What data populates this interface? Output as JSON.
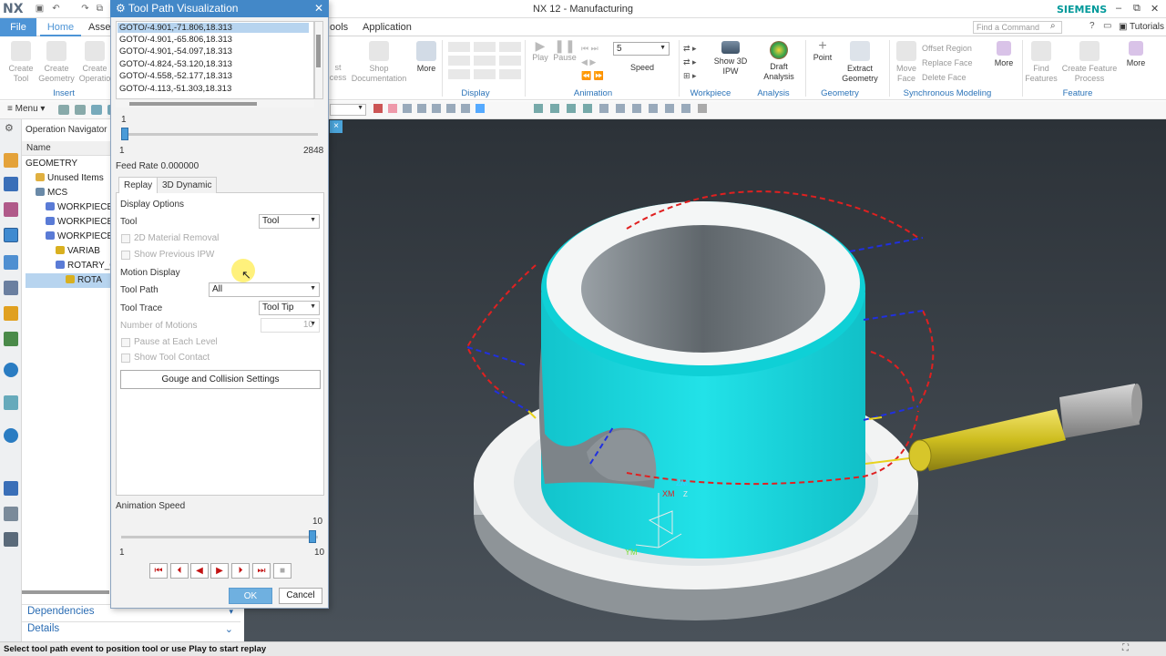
{
  "app": {
    "logo": "NX",
    "window_title": "NX 12 - Manufacturing",
    "brand": "SIEMENS",
    "tutorials": "Tutorials",
    "find_placeholder": "Find a Command"
  },
  "menu": {
    "file": "File",
    "home": "Home",
    "assemblies": "Asse",
    "tools": "ools",
    "application": "Application"
  },
  "ribbon": {
    "create_tool": [
      "Create",
      "Tool"
    ],
    "create_geometry": [
      "Create",
      "Geometry"
    ],
    "create_operation": [
      "Create",
      "Operatio"
    ],
    "insert_group": "Insert",
    "process": [
      "st",
      "cess"
    ],
    "shop_documentation": [
      "Shop",
      "Documentation"
    ],
    "more": "More",
    "display_group": "Display",
    "play": "Play",
    "pause": "Pause",
    "speed_value": "5",
    "speed": "Speed",
    "animation_group": "Animation",
    "show_3d_ipw": [
      "Show 3D",
      "IPW"
    ],
    "workpiece_group": "Workpiece",
    "draft_analysis": [
      "Draft",
      "Analysis"
    ],
    "analysis_group": "Analysis",
    "point": "Point",
    "extract_geometry": [
      "Extract",
      "Geometry"
    ],
    "geometry_group": "Geometry",
    "move_face": [
      "Move",
      "Face"
    ],
    "offset_region": "Offset Region",
    "replace_face": "Replace Face",
    "delete_face": "Delete Face",
    "synchronous_group": "Synchronous Modeling",
    "more2": "More",
    "find_features": [
      "Find",
      "Features"
    ],
    "create_feature_process": [
      "Create Feature",
      "Process"
    ],
    "feature_group": "Feature",
    "more3": "More"
  },
  "toolbar": {
    "menu": "Menu"
  },
  "navigator": {
    "title": "Operation Navigator",
    "column_name": "Name",
    "items": [
      {
        "label": "GEOMETRY",
        "indent": 0
      },
      {
        "label": "Unused Items",
        "indent": 1
      },
      {
        "label": "MCS",
        "indent": 1
      },
      {
        "label": "WORKPIECE",
        "indent": 2
      },
      {
        "label": "WORKPIECE_",
        "indent": 2
      },
      {
        "label": "WORKPIECE_",
        "indent": 2
      },
      {
        "label": "VARIAB",
        "indent": 3
      },
      {
        "label": "ROTARY_C",
        "indent": 3
      },
      {
        "label": "ROTA",
        "indent": 4
      }
    ],
    "dependencies": "Dependencies",
    "details": "Details"
  },
  "dialog": {
    "title": "Tool Path Visualization",
    "goto_list": [
      "GOTO/-4.901,-71.806,18.313",
      "GOTO/-4.901,-65.806,18.313",
      "GOTO/-4.901,-54.097,18.313",
      "GOTO/-4.824,-53.120,18.313",
      "GOTO/-4.558,-52.177,18.313",
      "GOTO/-4.113,-51.303,18.313"
    ],
    "motion_value": "1",
    "motion_min": "1",
    "motion_max": "2848",
    "motion_fraction": 0.0,
    "feed_rate": "Feed Rate 0.000000",
    "tab_replay": "Replay",
    "tab_3d": "3D Dynamic",
    "display_options": "Display Options",
    "tool_label": "Tool",
    "tool_value": "Tool",
    "material_removal": "2D Material Removal",
    "show_previous_ipw": "Show Previous IPW",
    "motion_display": "Motion Display",
    "tool_path_label": "Tool Path",
    "tool_path_value": "All",
    "tool_trace_label": "Tool Trace",
    "tool_trace_value": "Tool Tip",
    "num_motions_label": "Number of Motions",
    "num_motions_value": "10",
    "pause_each_level": "Pause at Each Level",
    "show_tool_contact": "Show Tool Contact",
    "gouge_button": "Gouge and Collision Settings",
    "animation_speed": "Animation Speed",
    "speed_value": "10",
    "speed_min": "1",
    "speed_max": "10",
    "speed_fraction": 1.0,
    "ok": "OK",
    "cancel": "Cancel"
  },
  "viewport": {
    "axis_zm": "ZM",
    "axis_xm": "XM",
    "axis_ym": "YM",
    "axis_z": "Z"
  },
  "status": "Select tool path event to position tool or use Play to start replay",
  "colors": {
    "accent": "#4388c8",
    "part": "#19d6dd",
    "tool": "#d6c628",
    "path_feed": "#e02020",
    "path_rapid": "#2030e0",
    "siemens": "#00999a"
  }
}
